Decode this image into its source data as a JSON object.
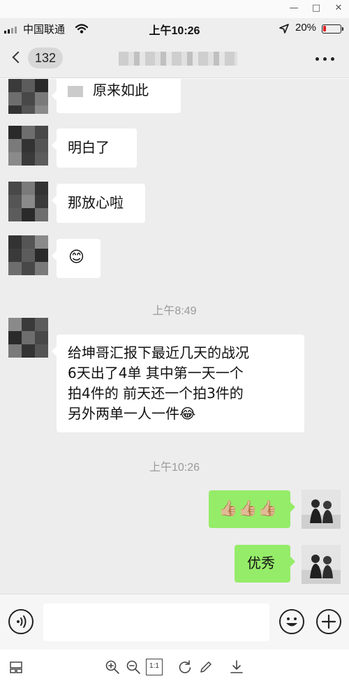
{
  "window": {
    "minimize_icon": "minimize-icon",
    "maximize_icon": "maximize-icon",
    "close_icon": "close-icon"
  },
  "status_bar": {
    "carrier": "中国联通",
    "time": "上午10:26",
    "battery": "20%",
    "battery_level": 0.2,
    "battery_color": "#e02020"
  },
  "header": {
    "unread_count": "132"
  },
  "messages": {
    "m1": "原来如此",
    "m2": "明白了",
    "m3": "那放心啦",
    "m4_emoji": "😊",
    "time_1": "上午8:49",
    "m5": "给坤哥汇报下最近几天的战况\n 6天出了4单  其中第一天一个\n拍4件的  前天还一个拍3件的\n另外两单一人一件😂",
    "time_2": "上午10:26",
    "m6": "👍🏼👍🏼👍🏼",
    "m7": "优秀"
  },
  "input": {
    "value": ""
  },
  "colors": {
    "chat_bg": "#ededed",
    "incoming_bubble": "#ffffff",
    "outgoing_bubble": "#95ec69"
  },
  "icons": {
    "voice": "voice-icon",
    "emoji": "smiley-icon",
    "plus": "plus-icon",
    "layout": "layout-icon",
    "zoom_in": "zoom-in-icon",
    "zoom_out": "zoom-out-icon",
    "actual_size": "actual-size-icon",
    "actual_size_text": "1:1",
    "rotate": "rotate-icon",
    "edit": "edit-icon",
    "download": "download-icon"
  }
}
